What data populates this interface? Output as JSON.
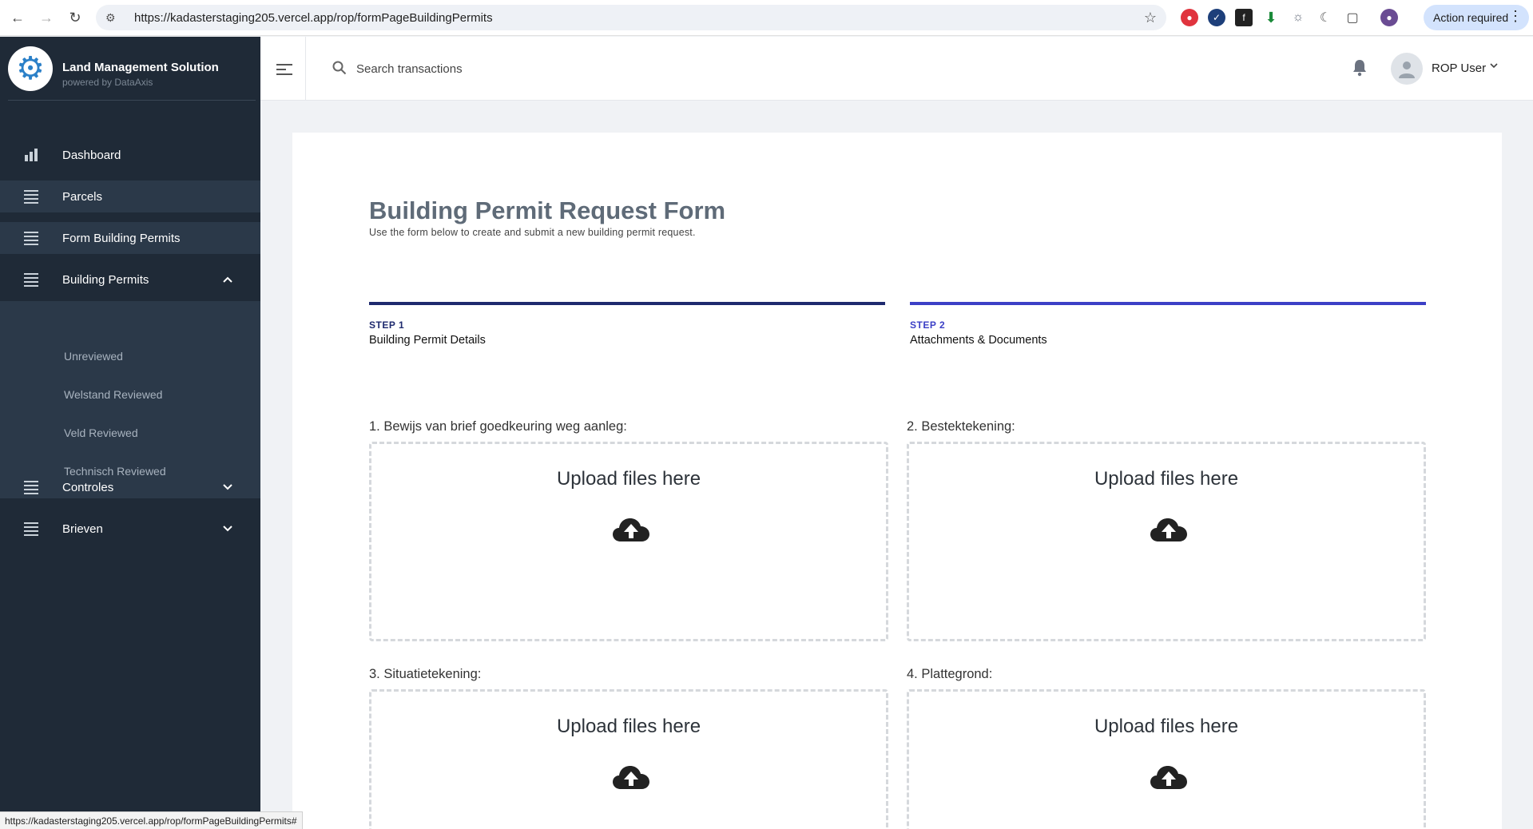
{
  "browser": {
    "url": "https://kadasterstaging205.vercel.app/rop/formPageBuildingPermits",
    "action_label": "Action required",
    "status_url": "https://kadasterstaging205.vercel.app/rop/formPageBuildingPermits#"
  },
  "brand": {
    "title": "Land Management Solution",
    "subtitle": "powered by DataAxis"
  },
  "sidebar": {
    "items": [
      {
        "label": "Dashboard"
      },
      {
        "label": "Parcels"
      },
      {
        "label": "Form Building Permits"
      },
      {
        "label": "Building Permits"
      },
      {
        "label": "Controles"
      },
      {
        "label": "Brieven"
      }
    ],
    "submenu": [
      {
        "label": "Unreviewed"
      },
      {
        "label": "Welstand Reviewed"
      },
      {
        "label": "Veld Reviewed"
      },
      {
        "label": "Technisch Reviewed"
      }
    ]
  },
  "header": {
    "search_placeholder": "Search transactions",
    "user_name": "ROP User"
  },
  "form": {
    "title": "Building Permit Request Form",
    "subtitle": "Use the form below to create and submit a new building permit request.",
    "steps": [
      {
        "num": "STEP 1",
        "name": "Building Permit Details",
        "color": "#1e2a6e"
      },
      {
        "num": "STEP 2",
        "name": "Attachments & Documents",
        "color": "#3c40c6"
      }
    ],
    "uploads": [
      {
        "label": "1. Bewijs van brief goedkeuring weg aanleg:",
        "text": "Upload files here"
      },
      {
        "label": "2. Bestektekening:",
        "text": "Upload files here"
      },
      {
        "label": "3. Situatietekening:",
        "text": "Upload files here"
      },
      {
        "label": "4. Plattegrond:",
        "text": "Upload files here"
      }
    ]
  },
  "colors": {
    "sidebar_bg": "#1f2a37",
    "sidebar_active": "#2b3949",
    "brand_blue": "#2b80c8"
  }
}
